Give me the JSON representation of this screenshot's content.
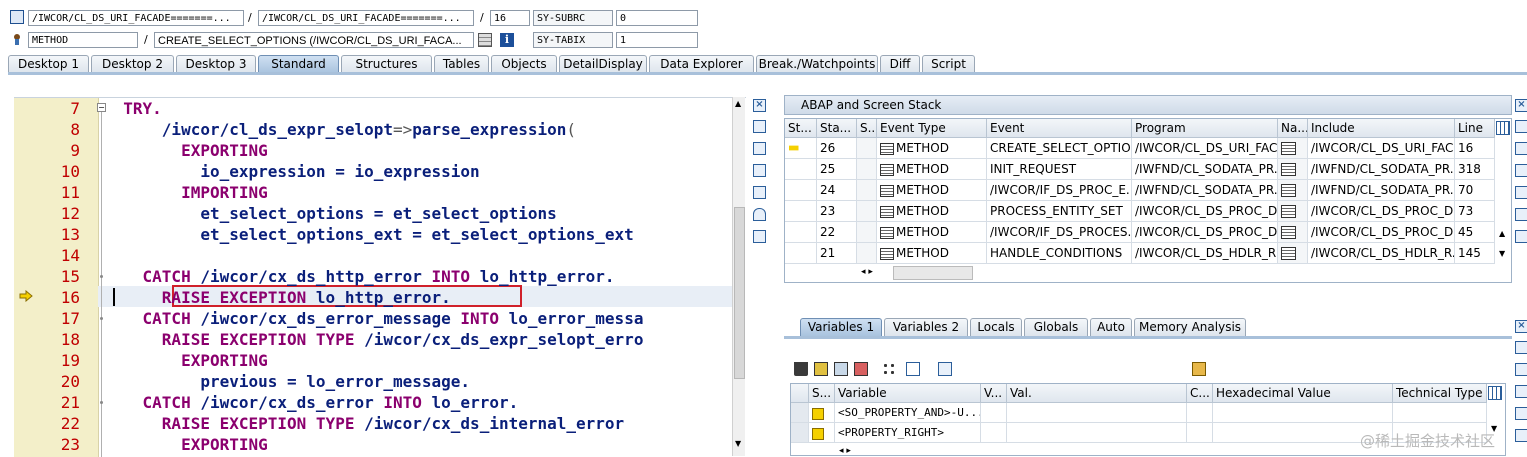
{
  "header": {
    "row1": {
      "field1": "/IWCOR/CL_DS_URI_FACADE=======...",
      "sep1": "/",
      "field2": "/IWCOR/CL_DS_URI_FACADE=======...",
      "sep2": "/",
      "line": "16",
      "sysvar": "SY-SUBRC",
      "sysval": "0"
    },
    "row2": {
      "type": "METHOD",
      "sep": "/",
      "method": "CREATE_SELECT_OPTIONS (/IWCOR/CL_DS_URI_FACA...",
      "sysvar": "SY-TABIX",
      "sysval": "1"
    }
  },
  "tabs": [
    "Desktop 1",
    "Desktop 2",
    "Desktop 3",
    "Standard",
    "Structures",
    "Tables",
    "Objects",
    "DetailDisplay",
    "Data Explorer",
    "Break./Watchpoints",
    "Diff",
    "Script"
  ],
  "active_tab": "Standard",
  "editor": {
    "lines": [
      {
        "n": "7",
        "segs": [
          [
            "kw",
            "  TRY."
          ]
        ]
      },
      {
        "n": "8",
        "segs": [
          [
            "id",
            "      /iwcor/cl_ds_expr_selopt"
          ],
          [
            "op",
            "=>"
          ],
          [
            "id",
            "parse_expression"
          ],
          [
            "op",
            "("
          ]
        ]
      },
      {
        "n": "9",
        "segs": [
          [
            "kw",
            "        EXPORTING"
          ]
        ]
      },
      {
        "n": "10",
        "segs": [
          [
            "id",
            "          io_expression = io_expression"
          ]
        ]
      },
      {
        "n": "11",
        "segs": [
          [
            "kw",
            "        IMPORTING"
          ]
        ]
      },
      {
        "n": "12",
        "segs": [
          [
            "id",
            "          et_select_options = et_select_options"
          ]
        ]
      },
      {
        "n": "13",
        "segs": [
          [
            "id",
            "          et_select_options_ext = et_select_options_ext"
          ]
        ]
      },
      {
        "n": "14",
        "segs": [
          [
            "id",
            ""
          ]
        ]
      },
      {
        "n": "15",
        "segs": [
          [
            "kw",
            "    CATCH "
          ],
          [
            "id",
            "/iwcor/cx_ds_http_error "
          ],
          [
            "kw",
            "INTO "
          ],
          [
            "id",
            "lo_http_error."
          ]
        ]
      },
      {
        "n": "16",
        "segs": [
          [
            "kw",
            "      RAISE EXCEPTION "
          ],
          [
            "id",
            "lo_http_error."
          ]
        ]
      },
      {
        "n": "17",
        "segs": [
          [
            "kw",
            "    CATCH "
          ],
          [
            "id",
            "/iwcor/cx_ds_error_message "
          ],
          [
            "kw",
            "INTO "
          ],
          [
            "id",
            "lo_error_messa"
          ]
        ]
      },
      {
        "n": "18",
        "segs": [
          [
            "kw",
            "      RAISE EXCEPTION TYPE "
          ],
          [
            "id",
            "/iwcor/cx_ds_expr_selopt_erro"
          ]
        ]
      },
      {
        "n": "19",
        "segs": [
          [
            "kw",
            "        EXPORTING"
          ]
        ]
      },
      {
        "n": "20",
        "segs": [
          [
            "id",
            "          previous = lo_error_message."
          ]
        ]
      },
      {
        "n": "21",
        "segs": [
          [
            "kw",
            "    CATCH "
          ],
          [
            "id",
            "/iwcor/cx_ds_error "
          ],
          [
            "kw",
            "INTO "
          ],
          [
            "id",
            "lo_error."
          ]
        ]
      },
      {
        "n": "22",
        "segs": [
          [
            "kw",
            "      RAISE EXCEPTION TYPE "
          ],
          [
            "id",
            "/iwcor/cx_ds_internal_error"
          ]
        ]
      },
      {
        "n": "23",
        "segs": [
          [
            "kw",
            "        EXPORTING"
          ]
        ]
      }
    ]
  },
  "stack": {
    "title": "ABAP and Screen Stack",
    "columns": [
      "St...",
      "Sta...",
      "S...",
      "Event Type",
      "Event",
      "Program",
      "Na...",
      "Include",
      "Line"
    ],
    "rows": [
      [
        "26",
        "METHOD",
        "CREATE_SELECT_OPTIO...",
        "/IWCOR/CL_DS_URI_FAC...",
        "/IWCOR/CL_DS_URI_FAC...",
        "16"
      ],
      [
        "25",
        "METHOD",
        "INIT_REQUEST",
        "/IWFND/CL_SODATA_PR...",
        "/IWFND/CL_SODATA_PR...",
        "318"
      ],
      [
        "24",
        "METHOD",
        "/IWCOR/IF_DS_PROC_E...",
        "/IWFND/CL_SODATA_PR...",
        "/IWFND/CL_SODATA_PR...",
        "70"
      ],
      [
        "23",
        "METHOD",
        "PROCESS_ENTITY_SET",
        "/IWCOR/CL_DS_PROC_D...",
        "/IWCOR/CL_DS_PROC_D...",
        "73"
      ],
      [
        "22",
        "METHOD",
        "/IWCOR/IF_DS_PROCES...",
        "/IWCOR/CL_DS_PROC_D...",
        "/IWCOR/CL_DS_PROC_D...",
        "45"
      ],
      [
        "21",
        "METHOD",
        "HANDLE_CONDITIONS",
        "/IWCOR/CL_DS_HDLR_R...",
        "/IWCOR/CL_DS_HDLR_R...",
        "145"
      ]
    ]
  },
  "var_tabs": [
    "Variables 1",
    "Variables 2",
    "Locals",
    "Globals",
    "Auto",
    "Memory Analysis"
  ],
  "vars": {
    "columns": [
      "S...",
      "Variable",
      "V...",
      "Val.",
      "C...",
      "Hexadecimal Value",
      "Technical Type"
    ],
    "rows": [
      [
        "<SO_PROPERTY_AND>-U..."
      ],
      [
        "<PROPERTY_RIGHT>"
      ]
    ]
  },
  "watermark": "@稀土掘金技术社区",
  "colors": {
    "keyword": "#8b006e",
    "identifier": "#0a1f7a",
    "linenum": "#c00000",
    "highlight_box": "#d0202a"
  }
}
